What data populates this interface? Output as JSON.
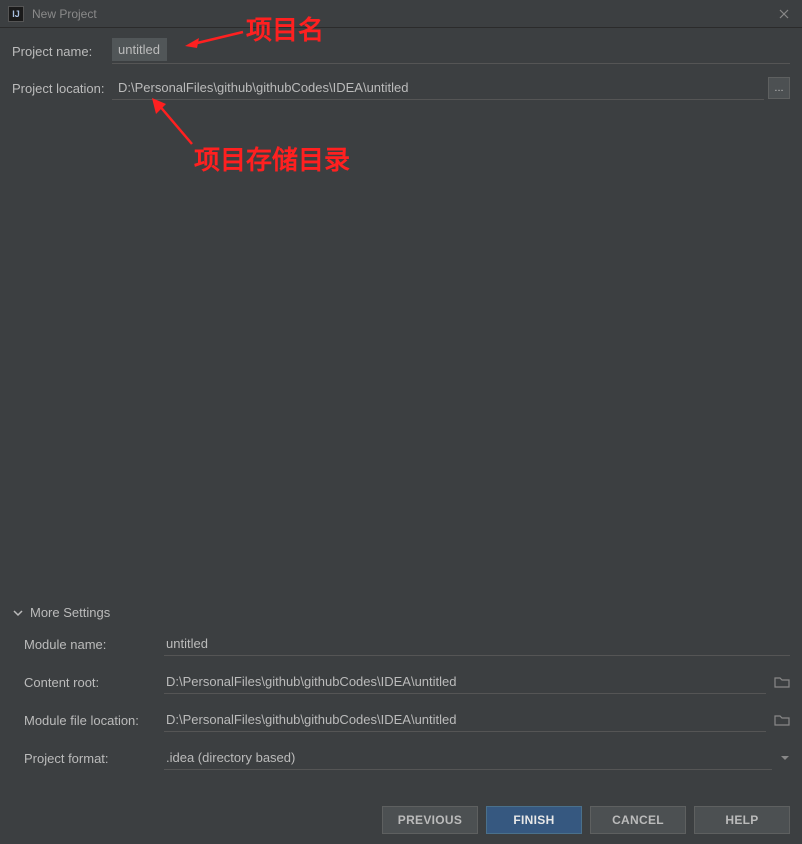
{
  "titlebar": {
    "title": "New Project"
  },
  "form": {
    "project_name_label": "Project name:",
    "project_name_value": "untitled",
    "project_location_label": "Project location:",
    "project_location_value": "D:\\PersonalFiles\\github\\githubCodes\\IDEA\\untitled",
    "browse_label": "..."
  },
  "more": {
    "header": "More Settings",
    "module_name_label": "Module name:",
    "module_name_value": "untitled",
    "content_root_label": "Content root:",
    "content_root_value": "D:\\PersonalFiles\\github\\githubCodes\\IDEA\\untitled",
    "module_file_loc_label": "Module file location:",
    "module_file_loc_value": "D:\\PersonalFiles\\github\\githubCodes\\IDEA\\untitled",
    "project_format_label": "Project format:",
    "project_format_value": ".idea (directory based)"
  },
  "buttons": {
    "previous": "PREVIOUS",
    "finish": "FINISH",
    "cancel": "CANCEL",
    "help": "HELP"
  },
  "annotations": {
    "project_name": "项目名",
    "project_storage": "项目存储目录"
  }
}
